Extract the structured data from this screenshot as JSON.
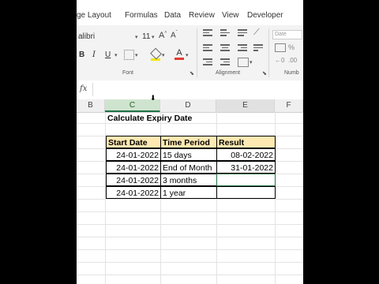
{
  "ribbon": {
    "tabs": [
      "ge Layout",
      "Formulas",
      "Data",
      "Review",
      "View",
      "Developer"
    ],
    "font_name": "alibri",
    "font_size": "11",
    "groups": {
      "font": "Font",
      "alignment": "Alignment",
      "number": "Numb"
    },
    "number_format": "Date",
    "accent": "#217346",
    "font_color": "#e03c31"
  },
  "formula_bar": {
    "fx": "fx",
    "value": ""
  },
  "columns": [
    "B",
    "C",
    "D",
    "E",
    "F"
  ],
  "sheet": {
    "title": "Calculate Expiry Date",
    "headers": [
      "Start Date",
      "Time Period",
      "Result"
    ],
    "rows": [
      [
        "24-01-2022",
        "15 days",
        "08-02-2022"
      ],
      [
        "24-01-2022",
        "End of Month",
        "31-01-2022"
      ],
      [
        "24-01-2022",
        "3 months",
        ""
      ],
      [
        "24-01-2022",
        "1 year",
        ""
      ]
    ],
    "header_fill": "#ffe9b3"
  }
}
